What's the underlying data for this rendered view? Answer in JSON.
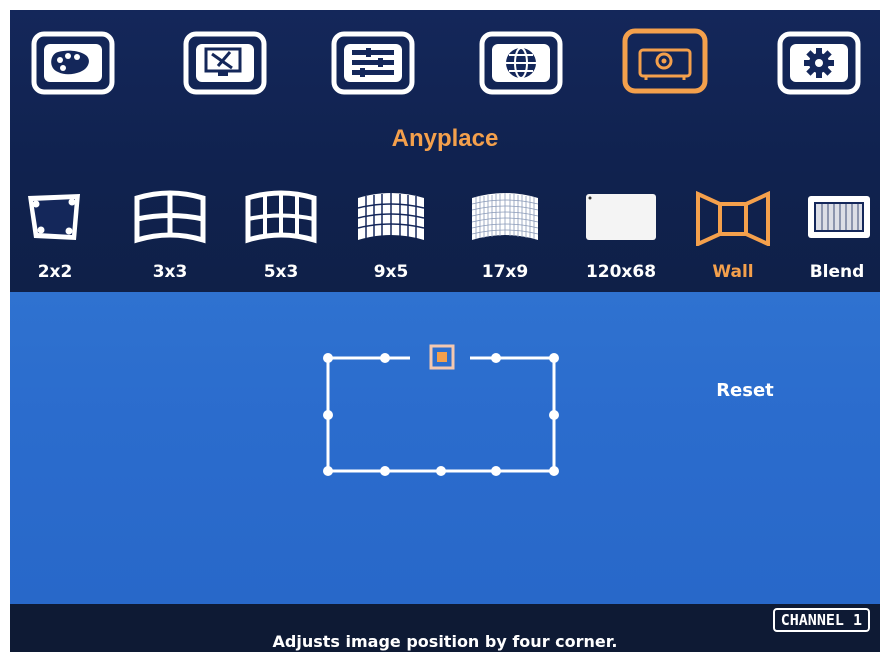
{
  "menu": {
    "icons": [
      {
        "name": "color-palette-icon",
        "selected": false
      },
      {
        "name": "monitor-settings-icon",
        "selected": false
      },
      {
        "name": "slider-bars-icon",
        "selected": false
      },
      {
        "name": "globe-icon",
        "selected": false
      },
      {
        "name": "projector-icon",
        "selected": true
      },
      {
        "name": "gear-icon",
        "selected": false
      }
    ],
    "accent_color": "#f4a04c"
  },
  "section_title": "Anyplace",
  "modes": [
    {
      "label": "2x2",
      "icon": "corner-quad-icon"
    },
    {
      "label": "3x3",
      "icon": "grid-3x3-icon"
    },
    {
      "label": "5x3",
      "icon": "grid-5x3-icon"
    },
    {
      "label": "9x5",
      "icon": "grid-9x5-icon"
    },
    {
      "label": "17x9",
      "icon": "grid-17x9-icon"
    },
    {
      "label": "120x68",
      "icon": "grid-120x68-icon"
    },
    {
      "label": "Wall",
      "icon": "wall-icon",
      "selected": true
    },
    {
      "label": "Blend",
      "icon": "blend-icon"
    }
  ],
  "reset_label": "Reset",
  "status": {
    "channel": "CHANNEL 1",
    "help": "Adjusts image position by four corner."
  }
}
